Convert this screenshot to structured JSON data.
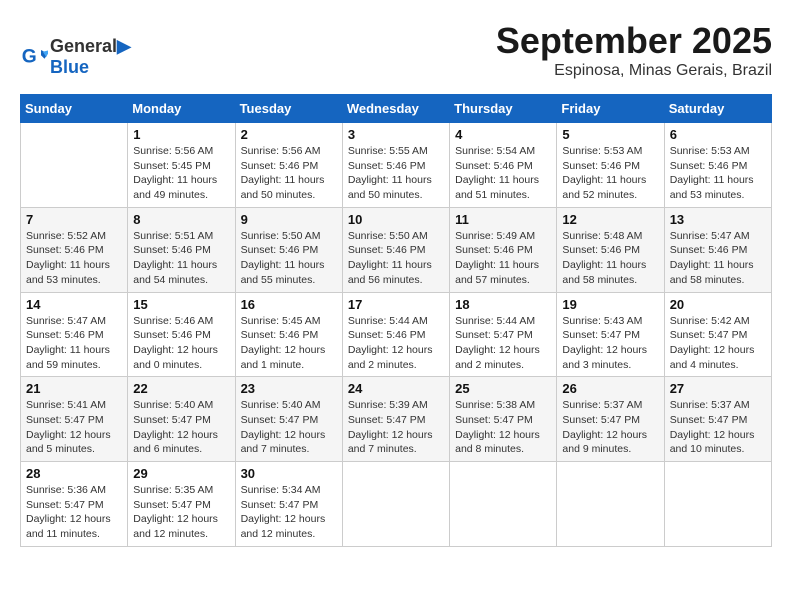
{
  "logo": {
    "line1": "General",
    "line2": "Blue"
  },
  "title": "September 2025",
  "location": "Espinosa, Minas Gerais, Brazil",
  "days_of_week": [
    "Sunday",
    "Monday",
    "Tuesday",
    "Wednesday",
    "Thursday",
    "Friday",
    "Saturday"
  ],
  "weeks": [
    [
      {
        "day": "",
        "info": ""
      },
      {
        "day": "1",
        "info": "Sunrise: 5:56 AM\nSunset: 5:45 PM\nDaylight: 11 hours\nand 49 minutes."
      },
      {
        "day": "2",
        "info": "Sunrise: 5:56 AM\nSunset: 5:46 PM\nDaylight: 11 hours\nand 50 minutes."
      },
      {
        "day": "3",
        "info": "Sunrise: 5:55 AM\nSunset: 5:46 PM\nDaylight: 11 hours\nand 50 minutes."
      },
      {
        "day": "4",
        "info": "Sunrise: 5:54 AM\nSunset: 5:46 PM\nDaylight: 11 hours\nand 51 minutes."
      },
      {
        "day": "5",
        "info": "Sunrise: 5:53 AM\nSunset: 5:46 PM\nDaylight: 11 hours\nand 52 minutes."
      },
      {
        "day": "6",
        "info": "Sunrise: 5:53 AM\nSunset: 5:46 PM\nDaylight: 11 hours\nand 53 minutes."
      }
    ],
    [
      {
        "day": "7",
        "info": "Sunrise: 5:52 AM\nSunset: 5:46 PM\nDaylight: 11 hours\nand 53 minutes."
      },
      {
        "day": "8",
        "info": "Sunrise: 5:51 AM\nSunset: 5:46 PM\nDaylight: 11 hours\nand 54 minutes."
      },
      {
        "day": "9",
        "info": "Sunrise: 5:50 AM\nSunset: 5:46 PM\nDaylight: 11 hours\nand 55 minutes."
      },
      {
        "day": "10",
        "info": "Sunrise: 5:50 AM\nSunset: 5:46 PM\nDaylight: 11 hours\nand 56 minutes."
      },
      {
        "day": "11",
        "info": "Sunrise: 5:49 AM\nSunset: 5:46 PM\nDaylight: 11 hours\nand 57 minutes."
      },
      {
        "day": "12",
        "info": "Sunrise: 5:48 AM\nSunset: 5:46 PM\nDaylight: 11 hours\nand 58 minutes."
      },
      {
        "day": "13",
        "info": "Sunrise: 5:47 AM\nSunset: 5:46 PM\nDaylight: 11 hours\nand 58 minutes."
      }
    ],
    [
      {
        "day": "14",
        "info": "Sunrise: 5:47 AM\nSunset: 5:46 PM\nDaylight: 11 hours\nand 59 minutes."
      },
      {
        "day": "15",
        "info": "Sunrise: 5:46 AM\nSunset: 5:46 PM\nDaylight: 12 hours\nand 0 minutes."
      },
      {
        "day": "16",
        "info": "Sunrise: 5:45 AM\nSunset: 5:46 PM\nDaylight: 12 hours\nand 1 minute."
      },
      {
        "day": "17",
        "info": "Sunrise: 5:44 AM\nSunset: 5:46 PM\nDaylight: 12 hours\nand 2 minutes."
      },
      {
        "day": "18",
        "info": "Sunrise: 5:44 AM\nSunset: 5:47 PM\nDaylight: 12 hours\nand 2 minutes."
      },
      {
        "day": "19",
        "info": "Sunrise: 5:43 AM\nSunset: 5:47 PM\nDaylight: 12 hours\nand 3 minutes."
      },
      {
        "day": "20",
        "info": "Sunrise: 5:42 AM\nSunset: 5:47 PM\nDaylight: 12 hours\nand 4 minutes."
      }
    ],
    [
      {
        "day": "21",
        "info": "Sunrise: 5:41 AM\nSunset: 5:47 PM\nDaylight: 12 hours\nand 5 minutes."
      },
      {
        "day": "22",
        "info": "Sunrise: 5:40 AM\nSunset: 5:47 PM\nDaylight: 12 hours\nand 6 minutes."
      },
      {
        "day": "23",
        "info": "Sunrise: 5:40 AM\nSunset: 5:47 PM\nDaylight: 12 hours\nand 7 minutes."
      },
      {
        "day": "24",
        "info": "Sunrise: 5:39 AM\nSunset: 5:47 PM\nDaylight: 12 hours\nand 7 minutes."
      },
      {
        "day": "25",
        "info": "Sunrise: 5:38 AM\nSunset: 5:47 PM\nDaylight: 12 hours\nand 8 minutes."
      },
      {
        "day": "26",
        "info": "Sunrise: 5:37 AM\nSunset: 5:47 PM\nDaylight: 12 hours\nand 9 minutes."
      },
      {
        "day": "27",
        "info": "Sunrise: 5:37 AM\nSunset: 5:47 PM\nDaylight: 12 hours\nand 10 minutes."
      }
    ],
    [
      {
        "day": "28",
        "info": "Sunrise: 5:36 AM\nSunset: 5:47 PM\nDaylight: 12 hours\nand 11 minutes."
      },
      {
        "day": "29",
        "info": "Sunrise: 5:35 AM\nSunset: 5:47 PM\nDaylight: 12 hours\nand 12 minutes."
      },
      {
        "day": "30",
        "info": "Sunrise: 5:34 AM\nSunset: 5:47 PM\nDaylight: 12 hours\nand 12 minutes."
      },
      {
        "day": "",
        "info": ""
      },
      {
        "day": "",
        "info": ""
      },
      {
        "day": "",
        "info": ""
      },
      {
        "day": "",
        "info": ""
      }
    ]
  ]
}
